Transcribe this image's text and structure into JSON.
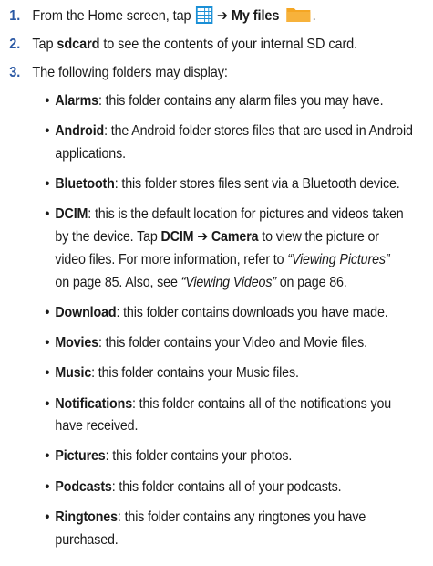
{
  "steps": [
    {
      "number": "1.",
      "text_before": "From the Home screen, tap",
      "arrow": "➔",
      "label": "My files",
      "icons": [
        "apps-grid-icon",
        "folder-icon"
      ],
      "icon_colors": {
        "apps": "#1a8fd6",
        "folder": "#f5a623"
      }
    },
    {
      "number": "2.",
      "text_before": "Tap",
      "label": "sdcard",
      "text_after": "to see the contents of your internal SD card."
    },
    {
      "number": "3.",
      "text": "The following folders may display:"
    }
  ],
  "folders": [
    {
      "name": "Alarms",
      "desc": ": this folder contains any alarm files you may have."
    },
    {
      "name": "Android",
      "desc": ": the Android folder stores files that are used in Android\napplications."
    },
    {
      "name": "Bluetooth",
      "desc": ": this folder stores files sent via a Bluetooth device."
    },
    {
      "name": "DCIM",
      "desc_1": ": this is the default location for pictures and videos taken\nby the device. Tap ",
      "tap_1": "DCIM",
      "arrow": " ➔ ",
      "tap_2": "Camera",
      "desc_2": " to view the picture or\nvideo files. For more information, refer to ",
      "ref_1": "“Viewing Pictures”",
      "desc_3": "\non page 85. Also, see ",
      "ref_2": "“Viewing Videos”",
      "desc_4": " on page 86."
    },
    {
      "name": "Download",
      "desc": ": this folder contains downloads you have made."
    },
    {
      "name": "Movies",
      "desc": ": this folder contains your Video and Movie files."
    },
    {
      "name": "Music",
      "desc": ": this folder contains your Music files."
    },
    {
      "name": "Notifications",
      "desc": ": this folder contains all of the notifications you\nhave received."
    },
    {
      "name": "Pictures",
      "desc": ": this folder contains your photos."
    },
    {
      "name": "Podcasts",
      "desc": ": this folder contains all of your podcasts."
    },
    {
      "name": "Ringtones",
      "desc": ": this folder contains any ringtones you have\npurchased."
    }
  ],
  "bullet_char": "•",
  "colors": {
    "step_number": "#2a58a4",
    "text": "#1a1a1a"
  }
}
